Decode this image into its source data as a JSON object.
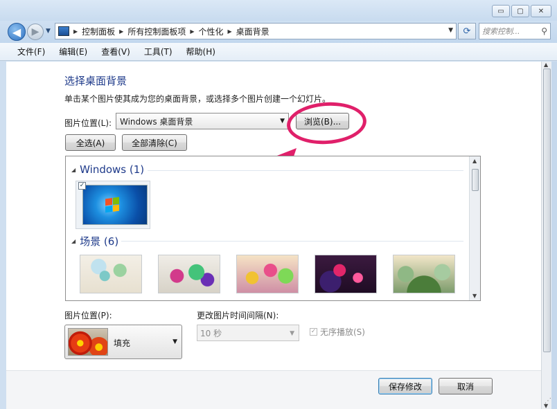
{
  "window": {
    "buttons": {
      "minimize": "▭",
      "maximize": "▢",
      "close": "✕"
    }
  },
  "nav": {
    "breadcrumbs": [
      "控制面板",
      "所有控制面板项",
      "个性化",
      "桌面背景"
    ],
    "search_placeholder": "搜索控制...",
    "back_glyph": "◀",
    "forward_glyph": "▶"
  },
  "menu": [
    "文件(F)",
    "编辑(E)",
    "查看(V)",
    "工具(T)",
    "帮助(H)"
  ],
  "page": {
    "title": "选择桌面背景",
    "description": "单击某个图片使其成为您的桌面背景，或选择多个图片创建一个幻灯片。",
    "location_label": "图片位置(L):",
    "location_value": "Windows 桌面背景",
    "browse_button": "浏览(B)...",
    "select_all_button": "全选(A)",
    "clear_all_button": "全部清除(C)"
  },
  "gallery": {
    "groups": [
      {
        "name": "Windows (1)"
      },
      {
        "name": "场景 (6)"
      }
    ]
  },
  "position": {
    "label": "图片位置(P):",
    "value": "填充"
  },
  "interval": {
    "label": "更改图片时间间隔(N):",
    "value": "10 秒"
  },
  "shuffle": {
    "label": "无序播放(S)",
    "checked": true
  },
  "footer": {
    "save_button": "保存修改",
    "cancel_button": "取消"
  },
  "colors": {
    "accent_heading": "#1e3a8a",
    "annotation": "#e0206a"
  }
}
